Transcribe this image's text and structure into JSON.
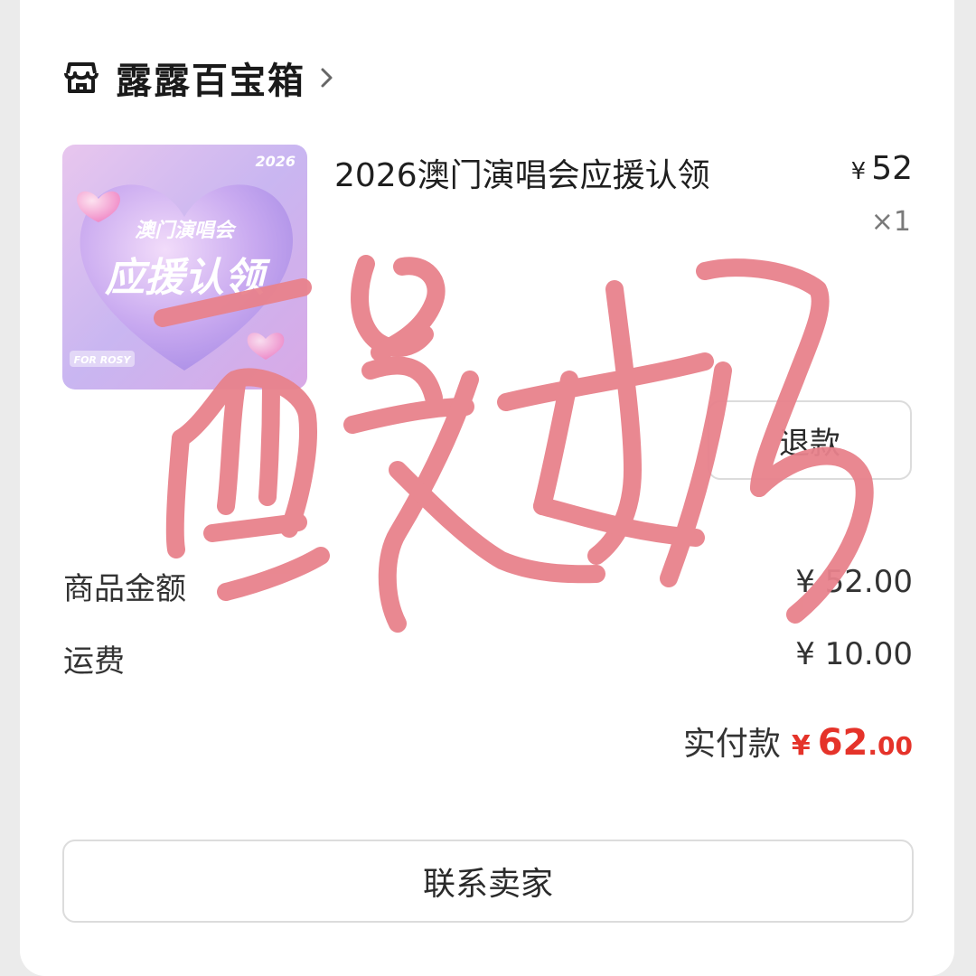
{
  "shop": {
    "name": "露露百宝箱"
  },
  "product": {
    "title": "2026澳门演唱会应援认领",
    "price_symbol": "¥",
    "price": "52",
    "quantity": "×1",
    "image": {
      "year": "2026",
      "subtitle": "澳门演唱会",
      "main": "应援认领",
      "tag": "FOR ROSY"
    }
  },
  "actions": {
    "refund_label": "退款",
    "contact_label": "联系卖家"
  },
  "summary": {
    "items_label": "商品金额",
    "items_value": "¥ 52.00",
    "shipping_label": "运费",
    "shipping_value": "¥ 10.00",
    "paid_label": "实付款",
    "paid_symbol": "¥",
    "paid_int": "62",
    "paid_dec": ".00"
  },
  "handwriting": {
    "text": "酸奶",
    "color": "#e8828c"
  },
  "colors": {
    "accent_red": "#e5332a",
    "border": "#dcdcdc"
  }
}
